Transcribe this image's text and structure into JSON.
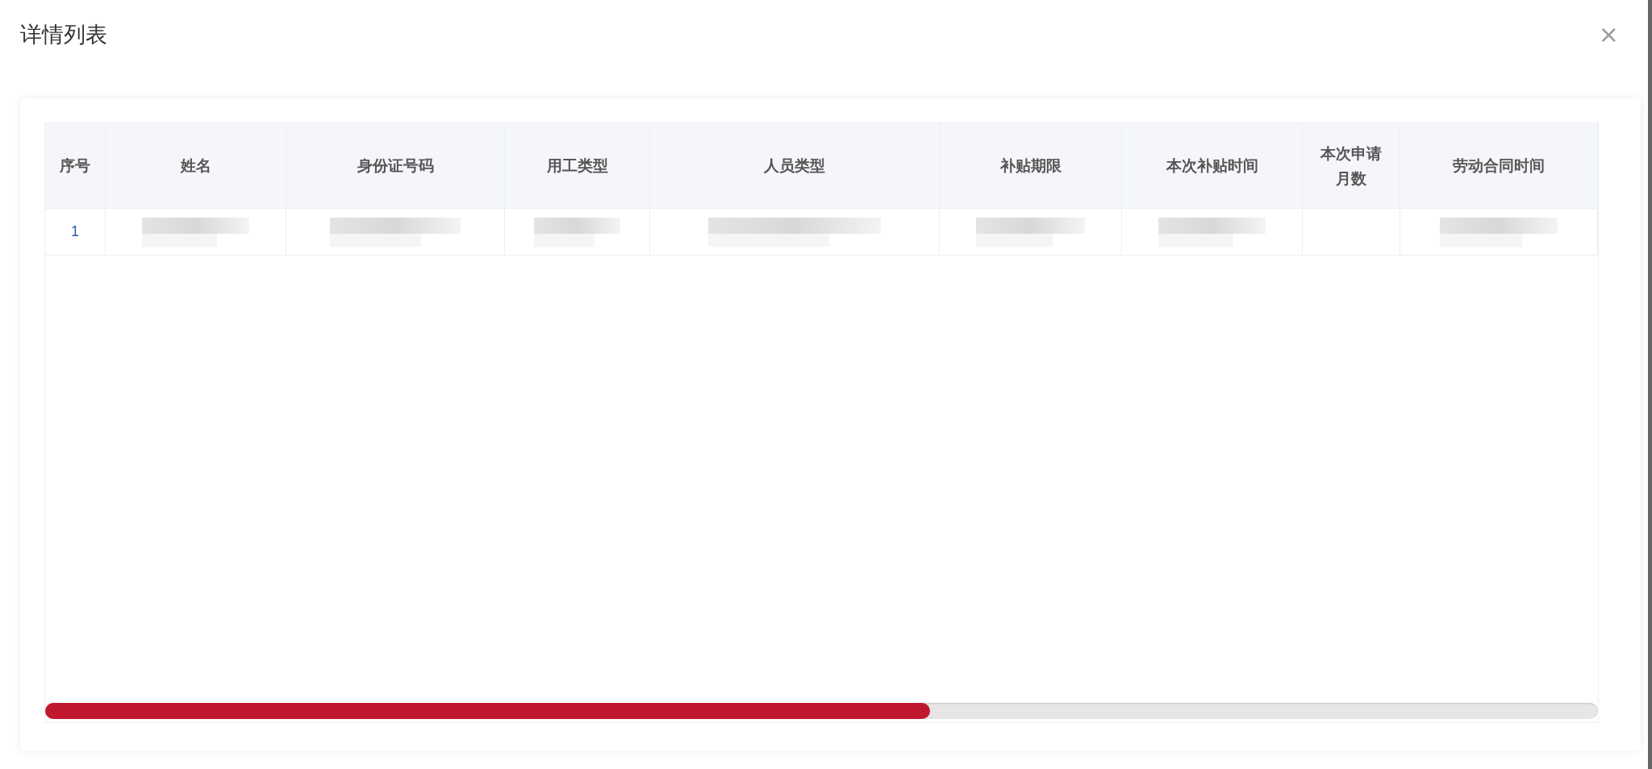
{
  "dialog": {
    "title": "详情列表",
    "close": "×"
  },
  "table": {
    "columns": [
      "序号",
      "姓名",
      "身份证号码",
      "用工类型",
      "人员类型",
      "补贴期限",
      "本次补贴时间",
      "本次申请月数",
      "劳动合同时间"
    ],
    "rows": [
      {
        "index": "1"
      }
    ]
  }
}
